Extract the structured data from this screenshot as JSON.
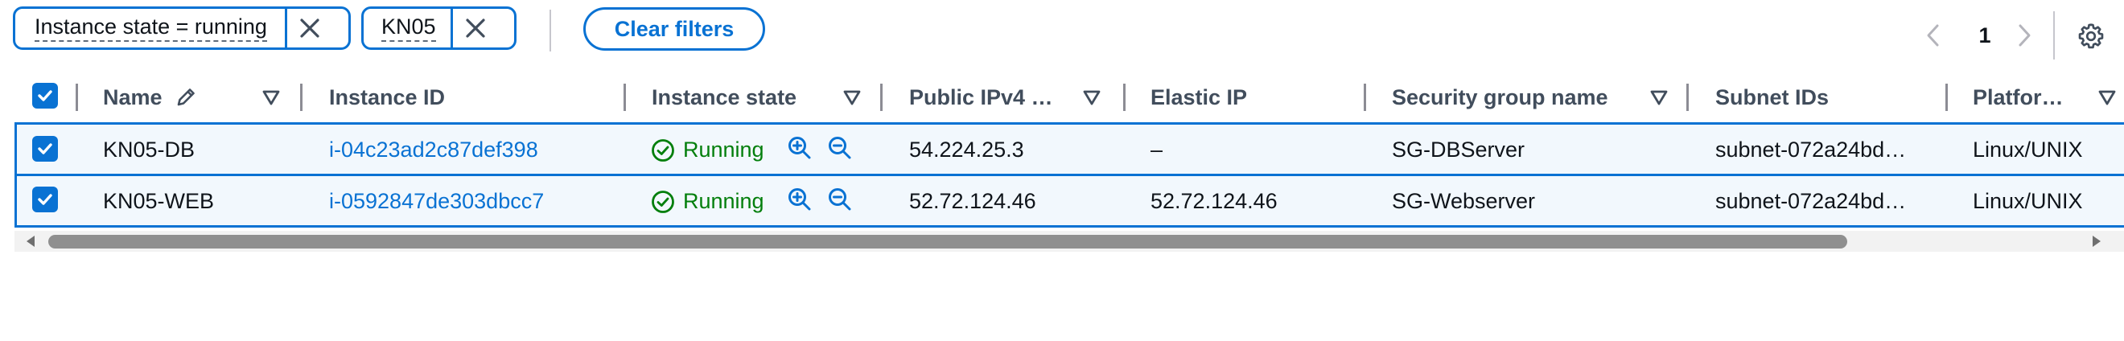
{
  "filters": {
    "tokens": [
      {
        "label": "Instance state = running"
      },
      {
        "label": "KN05"
      }
    ],
    "clear_label": "Clear filters"
  },
  "pagination": {
    "current_page": "1"
  },
  "table": {
    "columns": [
      "Name",
      "Instance ID",
      "Instance state",
      "Public IPv4 …",
      "Elastic IP",
      "Security group name",
      "Subnet IDs",
      "Platfor…"
    ],
    "rows": [
      {
        "name": "KN05-DB",
        "instance_id": "i-04c23ad2c87def398",
        "state": "Running",
        "public_ipv4": "54.224.25.3",
        "elastic_ip": "–",
        "security_group": "SG-DBServer",
        "subnet": "subnet-072a24bd…",
        "platform": "Linux/UNIX",
        "selected": true
      },
      {
        "name": "KN05-WEB",
        "instance_id": "i-0592847de303dbcc7",
        "state": "Running",
        "public_ipv4": "52.72.124.46",
        "elastic_ip": "52.72.124.46",
        "security_group": "SG-Webserver",
        "subnet": "subnet-072a24bd…",
        "platform": "Linux/UNIX",
        "selected": true
      }
    ]
  },
  "colors": {
    "accent": "#0972d3",
    "running": "#037f0c",
    "row_selected_bg": "#f2f8fd"
  }
}
